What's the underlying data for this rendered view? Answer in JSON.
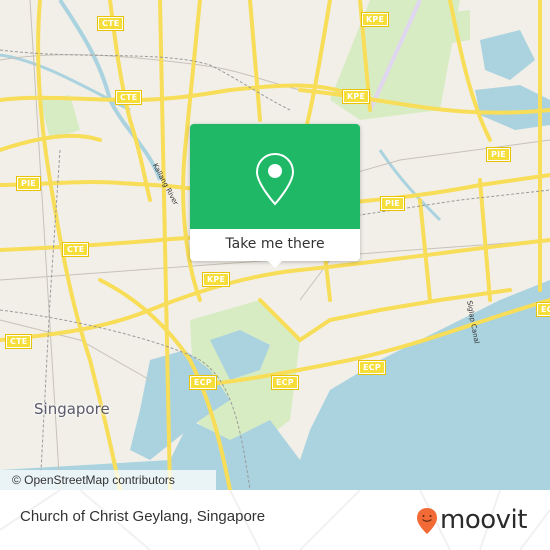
{
  "map": {
    "city_label": "Singapore",
    "highway_shields": [
      {
        "label": "CTE",
        "id": "cte-1"
      },
      {
        "label": "CTE",
        "id": "cte-2"
      },
      {
        "label": "CTE",
        "id": "cte-3"
      },
      {
        "label": "CTE",
        "id": "cte-4"
      },
      {
        "label": "PIE",
        "id": "pie-1"
      },
      {
        "label": "PIE",
        "id": "pie-2"
      },
      {
        "label": "PIE",
        "id": "pie-3"
      },
      {
        "label": "PIE",
        "id": "pie-4"
      },
      {
        "label": "KPE",
        "id": "kpe-1"
      },
      {
        "label": "KPE",
        "id": "kpe-2"
      },
      {
        "label": "KPE",
        "id": "kpe-3"
      },
      {
        "label": "ECP",
        "id": "ecp-1"
      },
      {
        "label": "ECP",
        "id": "ecp-2"
      },
      {
        "label": "ECP",
        "id": "ecp-3"
      },
      {
        "label": "ECP",
        "id": "ecp-4"
      }
    ],
    "water_labels": {
      "kallang": "Kallang River",
      "siglap": "Siglap Canal"
    },
    "attribution": "© OpenStreetMap contributors",
    "colors": {
      "land": "#f2efe9",
      "water": "#aad3df",
      "road": "#f7dd58",
      "park": "#cdebb0"
    }
  },
  "popup": {
    "icon": "location-pin-icon",
    "button_label": "Take me there",
    "color": "#1fb866"
  },
  "footer": {
    "place_name": "Church of Christ Geylang, Singapore",
    "brand": "moovit",
    "brand_color": "#f26a35"
  }
}
